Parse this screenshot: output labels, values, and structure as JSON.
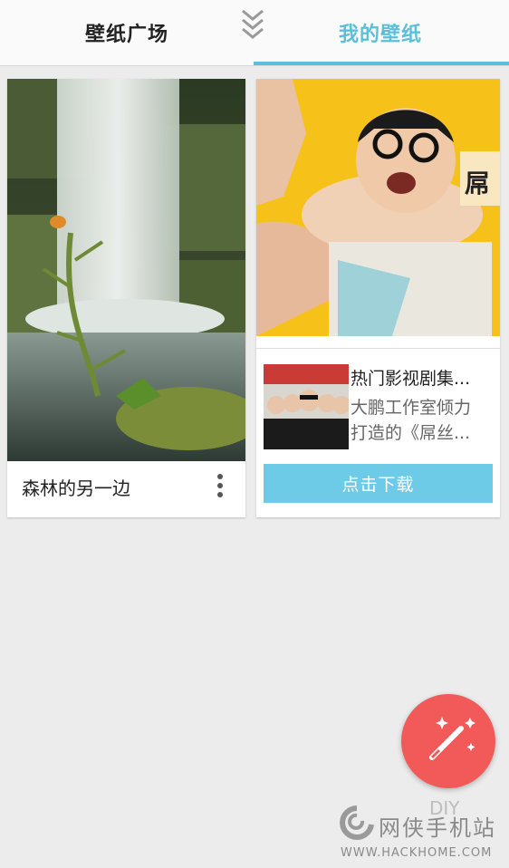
{
  "header": {
    "tabs": [
      {
        "label": "壁纸广场",
        "active": false
      },
      {
        "label": "我的壁纸",
        "active": true
      }
    ],
    "accent_color": "#5bbfdc"
  },
  "cards": [
    {
      "type": "wallpaper",
      "title": "森林的另一边",
      "image": "waterfall-flower-wallpaper"
    },
    {
      "type": "ad",
      "image": "movie-poster",
      "app_title": "热门影视剧集...",
      "desc_lines": [
        "大鹏工作室倾力",
        "打造的《屌丝..."
      ],
      "button_label": "点击下载",
      "button_color": "#6ecbe7"
    }
  ],
  "fab": {
    "icon": "magic-wand-icon",
    "color": "#f25a5a"
  },
  "watermark": {
    "diy": "DIY",
    "name": "网侠手机站",
    "url": "WWW.HACKHOME.COM"
  }
}
